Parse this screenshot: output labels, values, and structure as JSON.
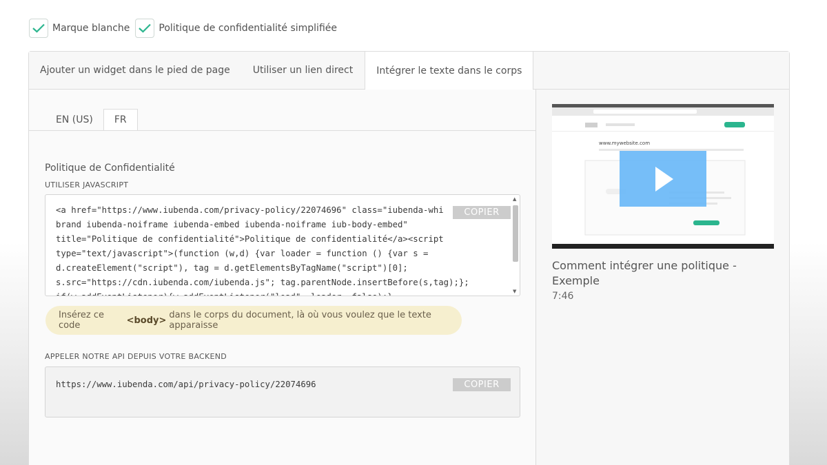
{
  "options": [
    {
      "label": "Marque blanche",
      "checked": true
    },
    {
      "label": "Politique de confidentialité simplifiée",
      "checked": true
    }
  ],
  "tabs": [
    {
      "label": "Ajouter un widget dans le pied de page"
    },
    {
      "label": "Utiliser un lien direct"
    },
    {
      "label": "Intégrer le texte dans le corps",
      "active": true
    }
  ],
  "lang_tabs": [
    {
      "label": "EN (US)"
    },
    {
      "label": "FR",
      "active": true
    }
  ],
  "policy": {
    "title": "Politique de Confidentialité",
    "js_label": "UTILISER JAVASCRIPT",
    "code_lines": [
      "<a href=\"https://www.iubenda.com/privacy-policy/22074696\" class=\"iubenda-whi",
      "brand iubenda-noiframe iubenda-embed iubenda-noiframe iub-body-embed\"",
      "title=\"Politique de confidentialité\">Politique de confidentialité</a><script",
      "type=\"text/javascript\">(function (w,d) {var loader = function () {var s =",
      "d.createElement(\"script\"), tag = d.getElementsByTagName(\"script\")[0];",
      "s.src=\"https://cdn.iubenda.com/iubenda.js\"; tag.parentNode.insertBefore(s,tag);};",
      "if(w.addEventListener){w.addEventListener(\"load\", loader, false);}"
    ],
    "copy_label": "COPIER"
  },
  "notice": {
    "before": "Insérez ce code",
    "code": "<body>",
    "after": "dans le corps du document, là où vous voulez que le texte apparaisse"
  },
  "api": {
    "label": "APPELER NOTRE API DEPUIS VOTRE BACKEND",
    "url": "https://www.iubenda.com/api/privacy-policy/22074696",
    "copy_label": "COPIER"
  },
  "video": {
    "thumb_site": "www.mywebsite.com",
    "title": "Comment intégrer une politique - Exemple",
    "duration": "7:46"
  },
  "colors": {
    "check": "#2bb58e",
    "play": "#6ab8f7",
    "copy_bg": "#cccccc",
    "notice_bg": "#f6efcf"
  }
}
